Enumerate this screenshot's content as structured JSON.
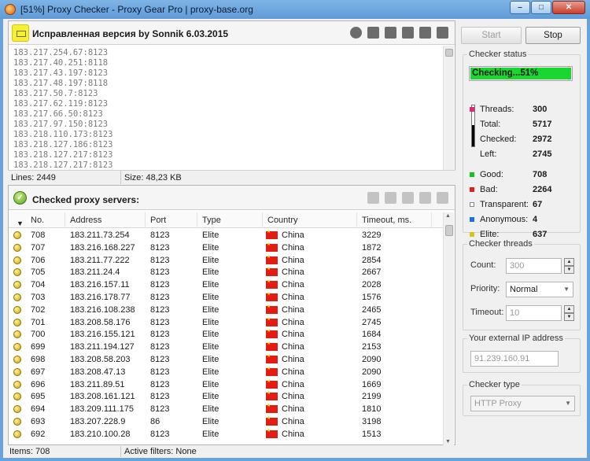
{
  "window": {
    "title": "[51%] Proxy Checker - Proxy Gear Pro | proxy-base.org"
  },
  "source_panel": {
    "title": "Исправленная версия by Sonnik 6.03.2015",
    "ips": [
      "183.217.254.67:8123",
      "183.217.40.251:8118",
      "183.217.43.197:8123",
      "183.217.48.197:8118",
      "183.217.50.7:8123",
      "183.217.62.119:8123",
      "183.217.66.50:8123",
      "183.217.97.150:8123",
      "183.218.110.173:8123",
      "183.218.127.186:8123",
      "183.218.127.217:8123",
      "183.218.127.217:8123"
    ],
    "lines_label": "Lines: 2449",
    "size_label": "Size: 48,23 KB"
  },
  "checked_panel": {
    "title": "Checked proxy servers:",
    "columns": {
      "no": "No.",
      "address": "Address",
      "port": "Port",
      "type": "Type",
      "country": "Country",
      "timeout": "Timeout, ms."
    },
    "rows": [
      {
        "no": "708",
        "address": "183.211.73.254",
        "port": "8123",
        "type": "Elite",
        "country": "China",
        "timeout": "3229"
      },
      {
        "no": "707",
        "address": "183.216.168.227",
        "port": "8123",
        "type": "Elite",
        "country": "China",
        "timeout": "1872"
      },
      {
        "no": "706",
        "address": "183.211.77.222",
        "port": "8123",
        "type": "Elite",
        "country": "China",
        "timeout": "2854"
      },
      {
        "no": "705",
        "address": "183.211.24.4",
        "port": "8123",
        "type": "Elite",
        "country": "China",
        "timeout": "2667"
      },
      {
        "no": "704",
        "address": "183.216.157.11",
        "port": "8123",
        "type": "Elite",
        "country": "China",
        "timeout": "2028"
      },
      {
        "no": "703",
        "address": "183.216.178.77",
        "port": "8123",
        "type": "Elite",
        "country": "China",
        "timeout": "1576"
      },
      {
        "no": "702",
        "address": "183.216.108.238",
        "port": "8123",
        "type": "Elite",
        "country": "China",
        "timeout": "2465"
      },
      {
        "no": "701",
        "address": "183.208.58.176",
        "port": "8123",
        "type": "Elite",
        "country": "China",
        "timeout": "2745"
      },
      {
        "no": "700",
        "address": "183.216.155.121",
        "port": "8123",
        "type": "Elite",
        "country": "China",
        "timeout": "1684"
      },
      {
        "no": "699",
        "address": "183.211.194.127",
        "port": "8123",
        "type": "Elite",
        "country": "China",
        "timeout": "2153"
      },
      {
        "no": "698",
        "address": "183.208.58.203",
        "port": "8123",
        "type": "Elite",
        "country": "China",
        "timeout": "2090"
      },
      {
        "no": "697",
        "address": "183.208.47.13",
        "port": "8123",
        "type": "Elite",
        "country": "China",
        "timeout": "2090"
      },
      {
        "no": "696",
        "address": "183.211.89.51",
        "port": "8123",
        "type": "Elite",
        "country": "China",
        "timeout": "1669"
      },
      {
        "no": "695",
        "address": "183.208.161.121",
        "port": "8123",
        "type": "Elite",
        "country": "China",
        "timeout": "2199"
      },
      {
        "no": "694",
        "address": "183.209.111.175",
        "port": "8123",
        "type": "Elite",
        "country": "China",
        "timeout": "1810"
      },
      {
        "no": "693",
        "address": "183.207.228.9",
        "port": "86",
        "type": "Elite",
        "country": "China",
        "timeout": "3198"
      },
      {
        "no": "692",
        "address": "183.210.100.28",
        "port": "8123",
        "type": "Elite",
        "country": "China",
        "timeout": "1513"
      }
    ],
    "items_label": "Items: 708",
    "filters_label": "Active filters: None"
  },
  "controls": {
    "start_label": "Start",
    "stop_label": "Stop"
  },
  "checker_status": {
    "title": "Checker status",
    "progress_text": "Checking...51%",
    "progress_fraction": 0.51,
    "stats": [
      {
        "label": "Threads:",
        "value": "300",
        "color": "#e0287a"
      },
      {
        "label": "Total:",
        "value": "5717",
        "color": ""
      },
      {
        "label": "Checked:",
        "value": "2972",
        "color": ""
      },
      {
        "label": "Left:",
        "value": "2745",
        "color": ""
      },
      {
        "label": "Good:",
        "value": "708",
        "color": "#17c21f"
      },
      {
        "label": "Bad:",
        "value": "2264",
        "color": "#e0201a"
      },
      {
        "label": "Transparent:",
        "value": "67",
        "color": "#ffffff"
      },
      {
        "label": "Anonymous:",
        "value": "4",
        "color": "#1f6fe0"
      },
      {
        "label": "Elite:",
        "value": "637",
        "color": "#d8c31a"
      }
    ]
  },
  "checker_threads": {
    "title": "Checker threads",
    "count_label": "Count:",
    "count_value": "300",
    "priority_label": "Priority:",
    "priority_value": "Normal",
    "timeout_label": "Timeout:",
    "timeout_value": "10"
  },
  "external_ip": {
    "title": "Your external IP address",
    "value": "91.239.160.91"
  },
  "checker_type": {
    "title": "Checker type",
    "value": "HTTP Proxy"
  }
}
